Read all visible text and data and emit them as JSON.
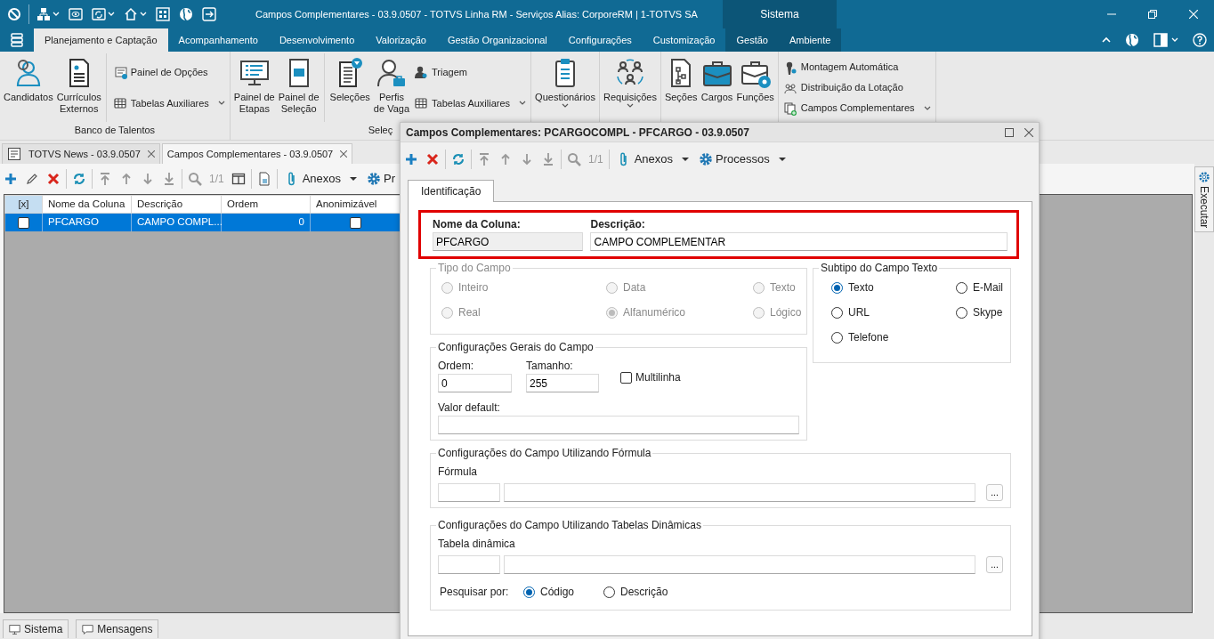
{
  "window": {
    "title": "Campos Complementares - 03.9.0507 - TOTVS Linha RM - Serviços  Alias: CorporeRM | 1-TOTVS SA",
    "context_tab": "Sistema"
  },
  "ribbon_tabs": [
    {
      "label": "Planejamento e Captação",
      "selected": true,
      "contextual": false
    },
    {
      "label": "Acompanhamento",
      "selected": false,
      "contextual": false
    },
    {
      "label": "Desenvolvimento",
      "selected": false,
      "contextual": false
    },
    {
      "label": "Valorização",
      "selected": false,
      "contextual": false
    },
    {
      "label": "Gestão Organizacional",
      "selected": false,
      "contextual": false
    },
    {
      "label": "Configurações",
      "selected": false,
      "contextual": false
    },
    {
      "label": "Customização",
      "selected": false,
      "contextual": false
    },
    {
      "label": "Gestão",
      "selected": false,
      "contextual": true
    },
    {
      "label": "Ambiente",
      "selected": false,
      "contextual": true
    }
  ],
  "ribbon_groups": [
    {
      "label": "Banco de Talentos",
      "sections": [
        [
          {
            "kind": "large",
            "label": "Candidatos"
          },
          {
            "kind": "large",
            "label": "Currículos\nExternos"
          }
        ],
        [
          {
            "kind": "small",
            "label": "Painel de Opções"
          },
          {
            "kind": "small-menu",
            "label": "Tabelas Auxiliares"
          }
        ]
      ]
    },
    {
      "label": "Seleç",
      "sections": [
        [
          {
            "kind": "large",
            "label": "Painel de\nEtapas"
          },
          {
            "kind": "large",
            "label": "Painel de\nSeleção"
          }
        ],
        [
          {
            "kind": "large",
            "label": "Seleções"
          },
          {
            "kind": "large",
            "label": "Perfis\nde Vaga"
          },
          {
            "kind": "small",
            "label": "Triagem"
          },
          {
            "kind": "small-menu",
            "label": "Tabelas Auxiliares"
          }
        ]
      ]
    },
    {
      "sections": [
        [
          {
            "kind": "large-menu",
            "label": "Questionários"
          }
        ]
      ]
    },
    {
      "sections": [
        [
          {
            "kind": "large-menu",
            "label": "Requisições"
          }
        ]
      ]
    },
    {
      "sections": [
        [
          {
            "kind": "large",
            "label": "Seções"
          },
          {
            "kind": "large",
            "label": "Cargos"
          },
          {
            "kind": "large",
            "label": "Funções"
          }
        ]
      ]
    },
    {
      "sections": [
        [
          {
            "kind": "small",
            "label": "Montagem Automática"
          },
          {
            "kind": "small",
            "label": "Distribuição da Lotação"
          },
          {
            "kind": "small-menu",
            "label": "Campos Complementares"
          }
        ]
      ]
    }
  ],
  "document_tabs": [
    {
      "label": "TOTVS News - 03.9.0507",
      "selected": false
    },
    {
      "label": "Campos Complementares - 03.9.0507",
      "selected": true
    }
  ],
  "toolbar": {
    "record_counter": "1/1",
    "attachments": "Anexos",
    "processes": "Pr"
  },
  "table": {
    "selector_header": "[x]",
    "columns": [
      "Nome da Coluna",
      "Descrição",
      "Ordem",
      "Anonimizável"
    ],
    "rows": [
      {
        "selected": true,
        "checked": false,
        "cells": [
          "PFCARGO",
          "CAMPO COMPL...",
          "0"
        ],
        "anonymizable": false
      }
    ]
  },
  "side_panel": {
    "label": "Executar"
  },
  "status_tabs": [
    "Sistema",
    "Mensagens"
  ],
  "dialog": {
    "title": "Campos Complementares: PCARGOCOMPL - PFCARGO - 03.9.0507",
    "toolbar": {
      "record_counter": "1/1",
      "attachments": "Anexos",
      "processes": "Processos"
    },
    "tabs": [
      {
        "label": "Identificação",
        "selected": true
      }
    ],
    "key_fields": {
      "highlighted": true,
      "fields": [
        {
          "label": "Nome da Coluna:",
          "value": "PFCARGO",
          "readonly": true
        },
        {
          "label": "Descrição:",
          "value": "CAMPO COMPLEMENTAR",
          "readonly": false
        }
      ]
    },
    "field_type": {
      "legend": "Tipo do Campo",
      "disabled": true,
      "options": [
        {
          "label": "Inteiro",
          "selected": false
        },
        {
          "label": "Data",
          "selected": false
        },
        {
          "label": "Texto",
          "selected": false
        },
        {
          "label": "Real",
          "selected": false
        },
        {
          "label": "Alfanumérico",
          "selected": true
        },
        {
          "label": "Lógico",
          "selected": false
        }
      ]
    },
    "text_subtype": {
      "legend": "Subtipo do Campo Texto",
      "options": [
        {
          "label": "Texto",
          "selected": true
        },
        {
          "label": "E-Mail",
          "selected": false
        },
        {
          "label": "URL",
          "selected": false
        },
        {
          "label": "Skype",
          "selected": false
        },
        {
          "label": "Telefone",
          "selected": false
        }
      ]
    },
    "general": {
      "legend": "Configurações Gerais do Campo",
      "order": {
        "label": "Ordem:",
        "value": "0"
      },
      "size": {
        "label": "Tamanho:",
        "value": "255"
      },
      "multiline": {
        "label": "Multilinha",
        "checked": false
      },
      "default_value": {
        "label": "Valor default:"
      }
    },
    "formula": {
      "legend": "Configurações do Campo Utilizando Fórmula",
      "label": "Fórmula",
      "button": "..."
    },
    "dynamic_table": {
      "legend": "Configurações do Campo Utilizando Tabelas Dinâmicas",
      "label": "Tabela dinâmica",
      "button": "...",
      "search_by": {
        "label": "Pesquisar por:",
        "options": [
          {
            "label": "Código",
            "selected": true
          },
          {
            "label": "Descrição",
            "selected": false
          }
        ]
      }
    }
  }
}
